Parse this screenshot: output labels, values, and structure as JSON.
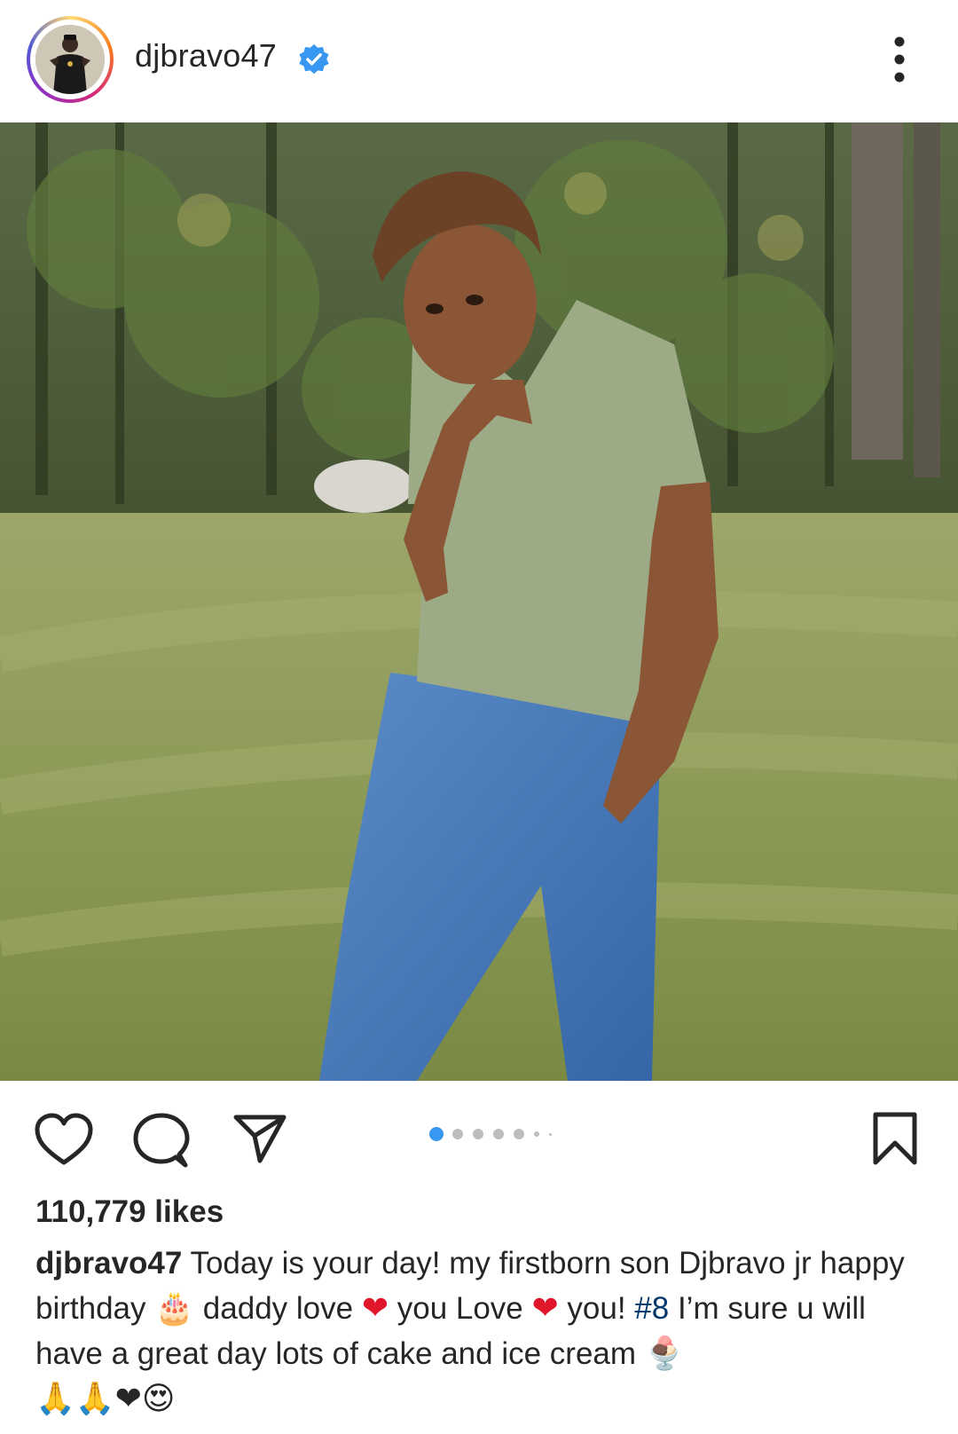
{
  "post": {
    "username": "djbravo47",
    "verified": true
  },
  "actions": {
    "like_icon": "heart-outline-icon",
    "comment_icon": "comment-bubble-icon",
    "share_icon": "paper-plane-icon",
    "save_icon": "bookmark-icon",
    "more_icon": "more-vertical-icon"
  },
  "carousel": {
    "total_dots": 7,
    "active_index": 0,
    "active_color": "#3897f0"
  },
  "likes_text": "110,779 likes",
  "caption": {
    "username": "djbravo47",
    "text_1": " Today is your day! my firstborn son Djbravo jr happy birthday ",
    "emoji_cake": "🎂",
    "text_2": " daddy love ",
    "emoji_heart_1": "❤",
    "text_3": " you Love ",
    "emoji_heart_2": "❤",
    "text_4": " you! ",
    "hashtag": "#8",
    "text_5": " I’m sure u will have a great day lots of cake and ice cream ",
    "emoji_icecream": "🍨",
    "emoji_end": "🙏🙏❤😍"
  },
  "colors": {
    "text": "#262626",
    "hashtag": "#00376b",
    "verified_badge": "#3897f0",
    "heart_emoji": "#e0162b"
  }
}
